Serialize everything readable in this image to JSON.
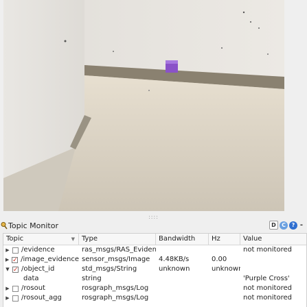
{
  "monitor": {
    "title": "Topic Monitor",
    "columns": {
      "topic": "Topic",
      "type": "Type",
      "bandwidth": "Bandwidth",
      "hz": "Hz",
      "value": "Value"
    },
    "rows": [
      {
        "topic": "/evidence",
        "type": "ras_msgs/RAS_Evidence",
        "bandwidth": "",
        "hz": "",
        "value": "not monitored",
        "checked": false,
        "expanded": false
      },
      {
        "topic": "/image_evidence",
        "type": "sensor_msgs/Image",
        "bandwidth": "4.48KB/s",
        "hz": "0.00",
        "value": "",
        "checked": true,
        "expanded": false
      },
      {
        "topic": "/object_id",
        "type": "std_msgs/String",
        "bandwidth": "unknown",
        "hz": "unknown",
        "value": "",
        "checked": true,
        "expanded": true
      },
      {
        "topic": "data",
        "type": "string",
        "bandwidth": "",
        "hz": "",
        "value": "'Purple Cross'"
      },
      {
        "topic": "/rosout",
        "type": "rosgraph_msgs/Log",
        "bandwidth": "",
        "hz": "",
        "value": "not monitored",
        "checked": false,
        "expanded": false
      },
      {
        "topic": "/rosout_agg",
        "type": "rosgraph_msgs/Log",
        "bandwidth": "",
        "hz": "",
        "value": "not monitored",
        "checked": false,
        "expanded": false
      }
    ]
  },
  "icons": {
    "header_buttons": [
      "dock-icon",
      "reload-icon",
      "help-icon",
      "close-icon"
    ],
    "help_glyph": "?",
    "close_glyph": "-",
    "dock_glyph": "D",
    "reload_glyph": "C"
  },
  "colors": {
    "checkmark": "#cc2b1d",
    "help_button": "#2f6fd0",
    "reload_button": "#6aa0e0"
  }
}
